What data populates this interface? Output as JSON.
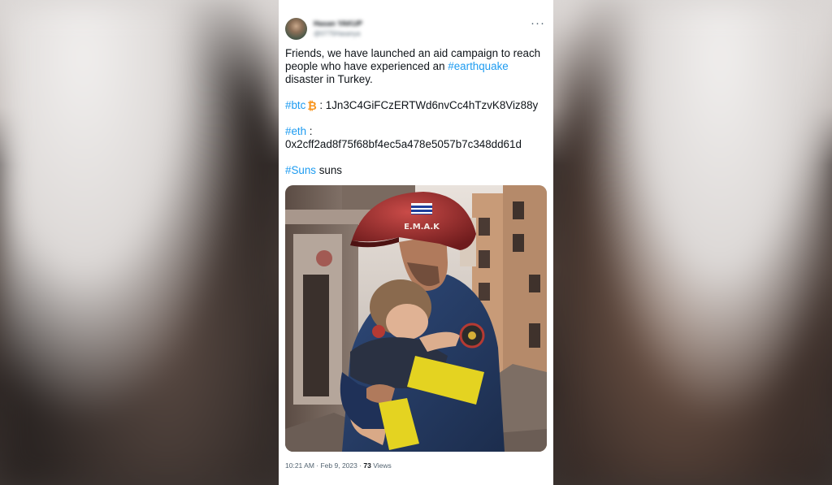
{
  "tweet": {
    "author_name": "Hasan YAKUP",
    "author_handle": "@0775Hasanya",
    "text_line1": "Friends, we have launched an aid campaign to reach people who have experienced an ",
    "earthquake_tag": "#earthquake",
    "text_line1_end": " disaster in Turkey.",
    "btc_tag": "#btc",
    "btc_icon": "bitcoin-icon",
    "btc_address": ": 1Jn3C4GiFCzERTWd6nvCc4hTzvK8Viz88y",
    "eth_tag": "#eth",
    "eth_colon": " :",
    "eth_address": "0x2cff2ad8f75f68bf4ec5a478e5057b7c348dd61d",
    "suns_tag": "#Suns",
    "suns_text": " suns",
    "helmet_text": "E.M.A.K",
    "time": "10:21 AM",
    "separator": " · ",
    "date": "Feb 9, 2023",
    "views_count": "73",
    "views_label": " Views"
  },
  "colors": {
    "link": "#1d9bf0",
    "text": "#0f1419",
    "muted": "#536471",
    "btc": "#f7931a"
  }
}
